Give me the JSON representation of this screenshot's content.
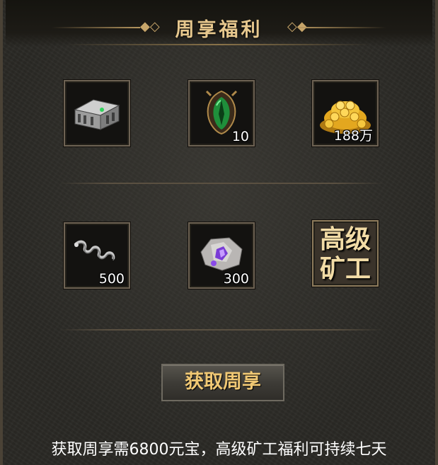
{
  "title": "周享福利",
  "items": [
    {
      "name": "silver-treasure-chest",
      "count": ""
    },
    {
      "name": "green-gem",
      "count": "10"
    },
    {
      "name": "gold-coin-pile",
      "count": "188万"
    },
    {
      "name": "silver-spring",
      "count": "500"
    },
    {
      "name": "purple-ore-crystal",
      "count": "300"
    },
    {
      "name": "senior-miner-badge",
      "label_line1": "高级",
      "label_line2": "矿工"
    }
  ],
  "button_label": "获取周享",
  "info": "获取周享需6800元宝，高级矿工福利可持续七天",
  "colors": {
    "title": "#e7c88e",
    "button_text": "#f0c874",
    "panel": "#2a2925"
  }
}
